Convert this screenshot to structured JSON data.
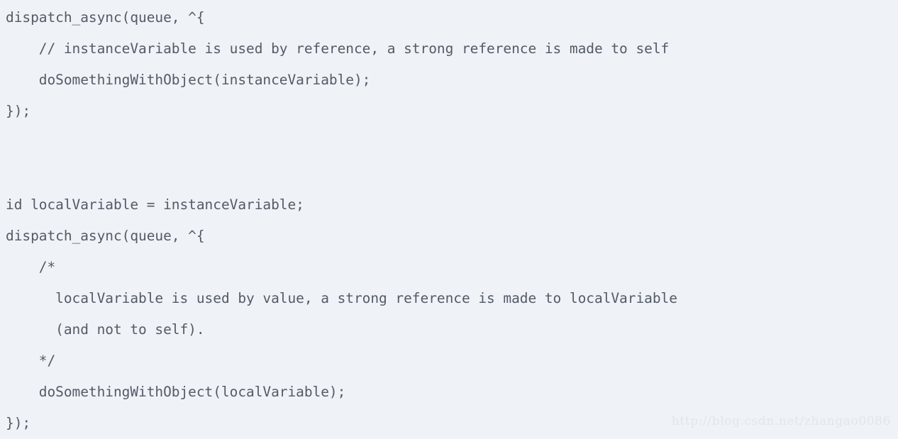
{
  "code_block": {
    "language": "objective-c",
    "background_color": "#eff2f7",
    "text_color": "#545b66",
    "lines": [
      "dispatch_async(queue, ^{",
      "    // instanceVariable is used by reference, a strong reference is made to self",
      "    doSomethingWithObject(instanceVariable);",
      "});",
      "",
      "",
      "id localVariable = instanceVariable;",
      "dispatch_async(queue, ^{",
      "    /*",
      "      localVariable is used by value, a strong reference is made to localVariable",
      "      (and not to self).",
      "    */",
      "    doSomethingWithObject(localVariable);",
      "});"
    ]
  },
  "watermark": {
    "text": "http://blog.csdn.net/zhangao0086",
    "color": "#e2e5ea"
  }
}
